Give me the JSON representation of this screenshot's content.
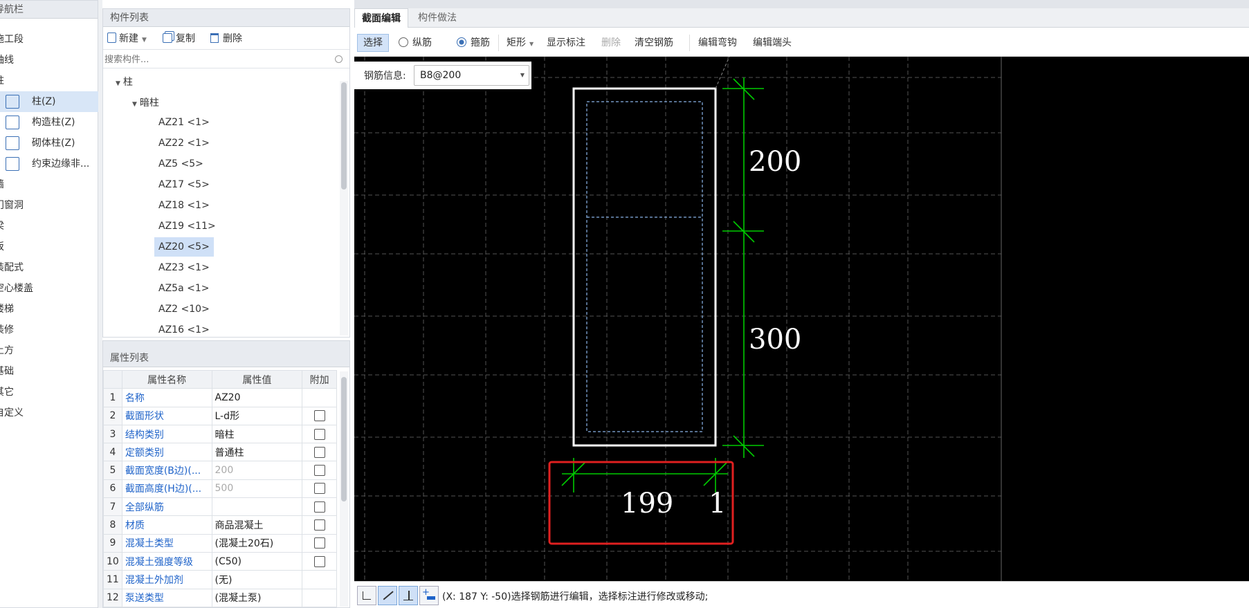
{
  "nav": {
    "title": "导航栏",
    "items": [
      {
        "label": "施工段"
      },
      {
        "label": "轴线"
      },
      {
        "label": "柱"
      },
      {
        "label": "柱(Z)",
        "icon": "column-icon",
        "selected": true
      },
      {
        "label": "构造柱(Z)",
        "icon": "constructional-column-icon"
      },
      {
        "label": "砌体柱(Z)",
        "icon": "masonry-column-icon"
      },
      {
        "label": "约束边缘非...",
        "icon": "constrained-edge-icon"
      },
      {
        "label": "墙"
      },
      {
        "label": "门窗洞"
      },
      {
        "label": "梁"
      },
      {
        "label": "板"
      },
      {
        "label": "装配式"
      },
      {
        "label": "空心楼盖"
      },
      {
        "label": "楼梯"
      },
      {
        "label": "装修"
      },
      {
        "label": "土方"
      },
      {
        "label": "基础"
      },
      {
        "label": "其它"
      },
      {
        "label": "自定义"
      }
    ]
  },
  "component_list": {
    "title": "构件列表",
    "toolbar": {
      "new_label": "新建",
      "copy_label": "复制",
      "delete_label": "删除"
    },
    "search_placeholder": "搜索构件...",
    "tree_root": "柱",
    "tree_group": "暗柱",
    "items": [
      {
        "label": "AZ21 <1>"
      },
      {
        "label": "AZ22 <1>"
      },
      {
        "label": "AZ5 <5>"
      },
      {
        "label": "AZ17 <5>"
      },
      {
        "label": "AZ18 <1>"
      },
      {
        "label": "AZ19 <11>"
      },
      {
        "label": "AZ20 <5>",
        "selected": true
      },
      {
        "label": "AZ23 <1>"
      },
      {
        "label": "AZ5a <1>"
      },
      {
        "label": "AZ2 <10>"
      },
      {
        "label": "AZ16 <1>"
      }
    ]
  },
  "properties": {
    "title": "属性列表",
    "headers": {
      "num": "",
      "name": "属性名称",
      "value": "属性值",
      "extra": "附加"
    },
    "rows": [
      {
        "num": "1",
        "name": "名称",
        "value": "AZ20",
        "check": false,
        "grey": false
      },
      {
        "num": "2",
        "name": "截面形状",
        "value": "L-d形",
        "check": true,
        "grey": false
      },
      {
        "num": "3",
        "name": "结构类别",
        "value": "暗柱",
        "check": true,
        "grey": false
      },
      {
        "num": "4",
        "name": "定额类别",
        "value": "普通柱",
        "check": true,
        "grey": false
      },
      {
        "num": "5",
        "name": "截面宽度(B边)(...",
        "value": "200",
        "check": true,
        "grey": true
      },
      {
        "num": "6",
        "name": "截面高度(H边)(...",
        "value": "500",
        "check": true,
        "grey": true
      },
      {
        "num": "7",
        "name": "全部纵筋",
        "value": "",
        "check": true,
        "grey": false
      },
      {
        "num": "8",
        "name": "材质",
        "value": "商品混凝土",
        "check": true,
        "grey": false
      },
      {
        "num": "9",
        "name": "混凝土类型",
        "value": "(混凝土20石)",
        "check": true,
        "grey": false
      },
      {
        "num": "10",
        "name": "混凝土强度等级",
        "value": "(C50)",
        "check": true,
        "grey": false
      },
      {
        "num": "11",
        "name": "混凝土外加剂",
        "value": "(无)",
        "check": false,
        "grey": false
      },
      {
        "num": "12",
        "name": "泵送类型",
        "value": "(混凝土泵)",
        "check": false,
        "grey": false
      }
    ]
  },
  "editor": {
    "tabs": [
      {
        "label": "截面编辑",
        "active": true
      },
      {
        "label": "构件做法",
        "active": false
      }
    ],
    "toolbar": {
      "select": "选择",
      "longitudinal": "纵筋",
      "stirrup": "箍筋",
      "shape": "矩形",
      "show_annotation": "显示标注",
      "delete": "删除",
      "clear_rebar": "清空钢筋",
      "edit_hook": "编辑弯钩",
      "edit_end": "编辑端头"
    },
    "rebar_info_label": "钢筋信息:",
    "rebar_info_value": "B8@200",
    "dims": {
      "d1": "200",
      "d2": "300",
      "d3": "199",
      "d4": "1"
    }
  },
  "status": {
    "text": "(X: 187 Y: -50)选择钢筋进行编辑，选择标注进行修改或移动;"
  },
  "colors": {
    "accent": "#1f63c9",
    "canvas_bg": "#000000",
    "dim_line": "#00cc00",
    "highlight_box": "#e02020"
  }
}
